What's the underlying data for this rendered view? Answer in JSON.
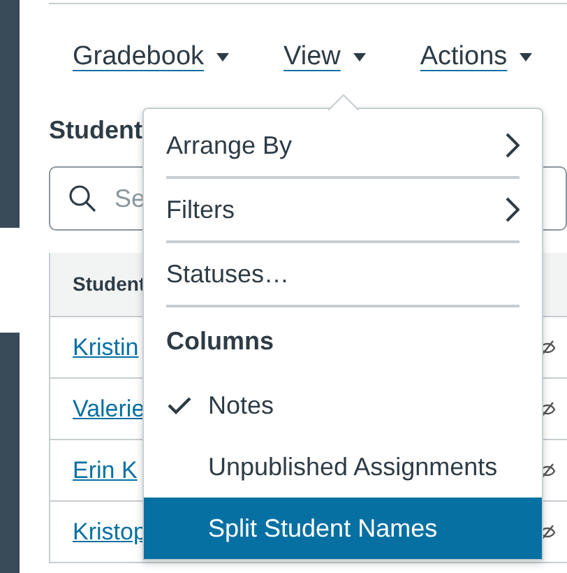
{
  "nav": [
    {
      "label": "Gradebook"
    },
    {
      "label": "View"
    },
    {
      "label": "Actions"
    }
  ],
  "heading": "Student",
  "search": {
    "placeholder": "Se"
  },
  "table": {
    "columns": [
      "Student"
    ],
    "rows": [
      {
        "name": "Kristin"
      },
      {
        "name": "Valerie"
      },
      {
        "name": "Erin K"
      },
      {
        "name": "Kristop"
      }
    ]
  },
  "menu": {
    "items": [
      {
        "kind": "submenu",
        "label": "Arrange By",
        "selected": false
      },
      {
        "kind": "separator"
      },
      {
        "kind": "submenu",
        "label": "Filters",
        "selected": false
      },
      {
        "kind": "separator"
      },
      {
        "kind": "item",
        "label": "Statuses…",
        "selected": false
      },
      {
        "kind": "separator"
      },
      {
        "kind": "header",
        "label": "Columns"
      },
      {
        "kind": "toggle",
        "label": "Notes",
        "checked": true,
        "selected": false
      },
      {
        "kind": "toggle",
        "label": "Unpublished Assignments",
        "checked": false,
        "selected": false
      },
      {
        "kind": "toggle",
        "label": "Split Student Names",
        "checked": false,
        "selected": true
      }
    ]
  }
}
